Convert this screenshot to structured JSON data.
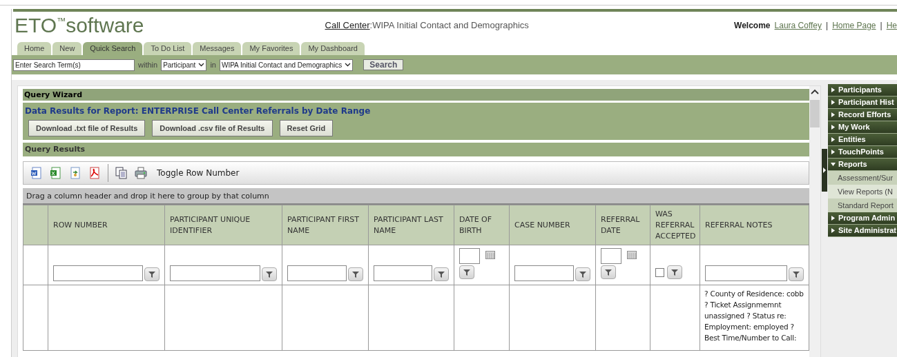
{
  "header": {
    "logo": {
      "name": "ETO",
      "mark": "™",
      "suffix": "software"
    },
    "context_link": "Call Center",
    "context_text": ":WIPA Initial Contact and Demographics",
    "welcome": "Welcome",
    "separator": "|",
    "links": [
      "Laura Coffey",
      "Home Page",
      "He"
    ]
  },
  "tabs": [
    {
      "label": "Home",
      "selected": false
    },
    {
      "label": "New",
      "selected": false
    },
    {
      "label": "Quick Search",
      "selected": true
    },
    {
      "label": "To Do List",
      "selected": false
    },
    {
      "label": "Messages",
      "selected": false
    },
    {
      "label": "My Favorites",
      "selected": false
    },
    {
      "label": "My Dashboard",
      "selected": false
    }
  ],
  "search": {
    "value": "Enter Search Term(s)",
    "within_label": "within",
    "within_value": "Participant",
    "in_label": "in",
    "in_value": "WIPA Initial Contact and Demographics",
    "button": "Search"
  },
  "query_wizard": {
    "title": "Query Wizard",
    "report_title": "Data Results for Report: ENTERPRISE Call Center Referrals by Date Range",
    "buttons": [
      "Download .txt file of Results",
      "Download .csv file of Results",
      "Reset Grid"
    ],
    "results_title": "Query Results"
  },
  "toolbar": {
    "icons": [
      {
        "kind": "word"
      },
      {
        "kind": "excel"
      },
      {
        "kind": "import"
      },
      {
        "kind": "pdf"
      },
      {
        "kind": "copy"
      },
      {
        "kind": "print"
      }
    ],
    "toggle": "Toggle Row Number"
  },
  "group_hint": "Drag a column header and drop it here to group by that column",
  "table": {
    "columns": [
      {
        "label": "ROW NUMBER",
        "kind": "text"
      },
      {
        "label": "PARTICIPANT UNIQUE IDENTIFIER",
        "kind": "text"
      },
      {
        "label": "PARTICIPANT FIRST NAME",
        "kind": "text"
      },
      {
        "label": "PARTICIPANT LAST NAME",
        "kind": "text"
      },
      {
        "label": "DATE OF BIRTH",
        "kind": "date"
      },
      {
        "label": "CASE NUMBER",
        "kind": "text"
      },
      {
        "label": "REFERRAL DATE",
        "kind": "date"
      },
      {
        "label": "WAS REFERRAL ACCEPTED",
        "kind": "checkbox",
        "checked": false
      },
      {
        "label": "REFERRAL NOTES",
        "kind": "text"
      }
    ],
    "rows": [
      {
        "cells": [
          "",
          "",
          "",
          "",
          "",
          "",
          "",
          "",
          "? County of Residence: cobb ? Ticket Assignmemnt unassigned ? Status re: Employment: employed ? Best Time/Number to Call:"
        ]
      }
    ]
  },
  "sidebar": {
    "items": [
      {
        "label": "Participants",
        "expanded": false
      },
      {
        "label": "Participant Hist",
        "expanded": false
      },
      {
        "label": "Record Efforts",
        "expanded": false
      },
      {
        "label": "My Work",
        "expanded": false
      },
      {
        "label": "Entities",
        "expanded": false
      },
      {
        "label": "TouchPoints",
        "expanded": false
      },
      {
        "label": "Reports",
        "expanded": true,
        "children": [
          "Assessment/Sur",
          "View Reports (N",
          "Standard Report"
        ]
      },
      {
        "label": "Program Admin",
        "expanded": false
      },
      {
        "label": "Site Administrat",
        "expanded": false
      }
    ]
  }
}
